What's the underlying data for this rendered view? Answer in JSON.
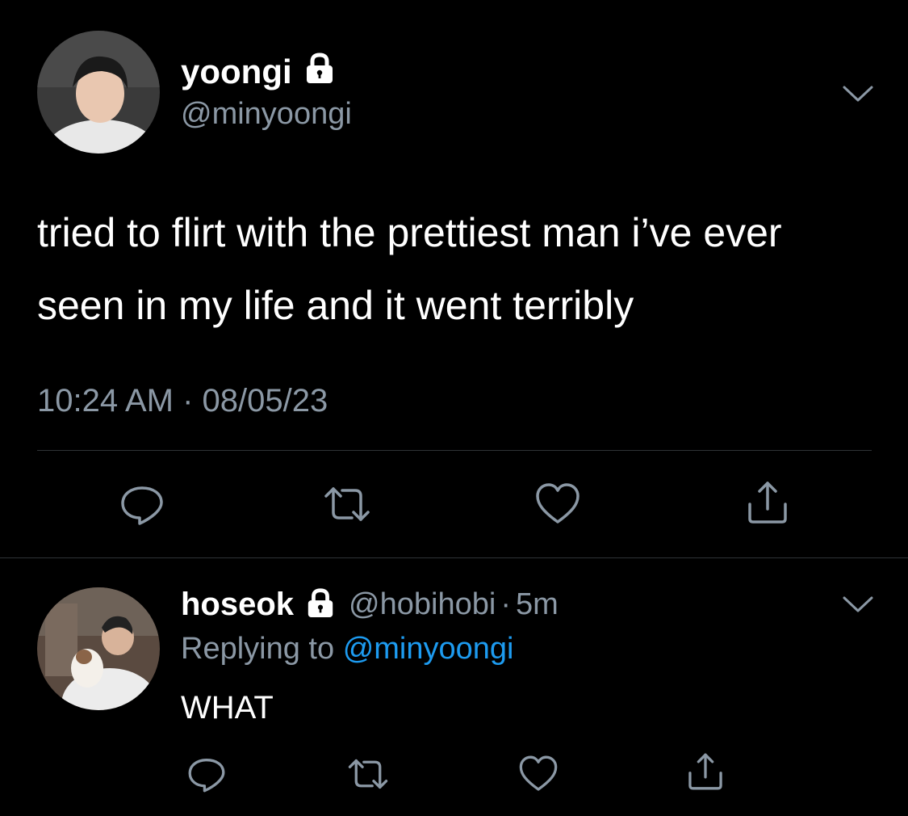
{
  "colors": {
    "background": "#000000",
    "text_primary": "#ffffff",
    "text_secondary": "#8b98a5",
    "link": "#1d9bf0",
    "divider": "#2f3336"
  },
  "main_tweet": {
    "display_name": "yoongi",
    "handle": "@minyoongi",
    "protected_icon": "lock-icon",
    "text": "tried to flirt with the prettiest man i’ve ever seen in my life and it went terribly",
    "timestamp": "10:24 AM · 08/05/23",
    "actions": [
      "reply-icon",
      "retweet-icon",
      "like-icon",
      "share-icon"
    ]
  },
  "reply_tweet": {
    "display_name": "hoseok",
    "handle": "@hobihobi",
    "separator": "·",
    "time": "5m",
    "protected_icon": "lock-icon",
    "replying_label": "Replying to",
    "replying_to": "@minyoongi",
    "text": "WHAT",
    "actions": [
      "reply-icon",
      "retweet-icon",
      "like-icon",
      "share-icon"
    ]
  }
}
